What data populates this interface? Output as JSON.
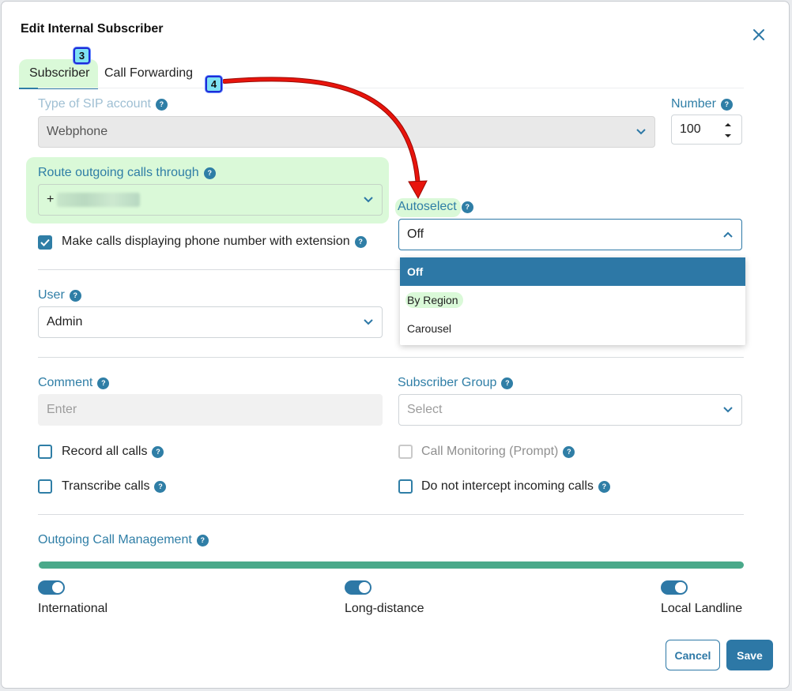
{
  "dialog": {
    "title": "Edit Internal Subscriber",
    "close_icon": "close-icon"
  },
  "tabs": [
    {
      "label": "Subscriber",
      "active": true
    },
    {
      "label": "Call Forwarding",
      "active": false
    }
  ],
  "annotations": {
    "badge_3": "3",
    "badge_4": "4"
  },
  "sip": {
    "label": "Type of SIP account",
    "value": "Webphone"
  },
  "number": {
    "label": "Number",
    "value": "100"
  },
  "route": {
    "label": "Route outgoing calls through",
    "value": "+"
  },
  "make_calls": {
    "label": "Make calls displaying phone number with extension",
    "checked": true
  },
  "autoselect": {
    "label": "Autoselect",
    "value": "Off",
    "options": [
      "Off",
      "By Region",
      "Carousel"
    ],
    "selected": "Off"
  },
  "user": {
    "label": "User",
    "value": "Admin"
  },
  "comment": {
    "label": "Comment",
    "placeholder": "Enter"
  },
  "subscriber_group": {
    "label": "Subscriber Group",
    "placeholder": "Select"
  },
  "checkboxes": {
    "record": {
      "label": "Record all calls",
      "checked": false
    },
    "transcribe": {
      "label": "Transcribe calls",
      "checked": false
    },
    "monitoring": {
      "label": "Call Monitoring (Prompt)",
      "checked": false,
      "disabled": true
    },
    "intercept": {
      "label": "Do not intercept incoming calls",
      "checked": false
    }
  },
  "outgoing": {
    "label": "Outgoing Call Management",
    "toggles": [
      {
        "label": "International",
        "on": true
      },
      {
        "label": "Long-distance",
        "on": true
      },
      {
        "label": "Local Landline",
        "on": true
      }
    ]
  },
  "buttons": {
    "cancel": "Cancel",
    "save": "Save"
  },
  "help_glyph": "?",
  "colors": {
    "accent": "#2d78a6",
    "highlight": "#daf9d8",
    "bar": "#4aa98a",
    "annotation_arrow": "#e8140c"
  }
}
